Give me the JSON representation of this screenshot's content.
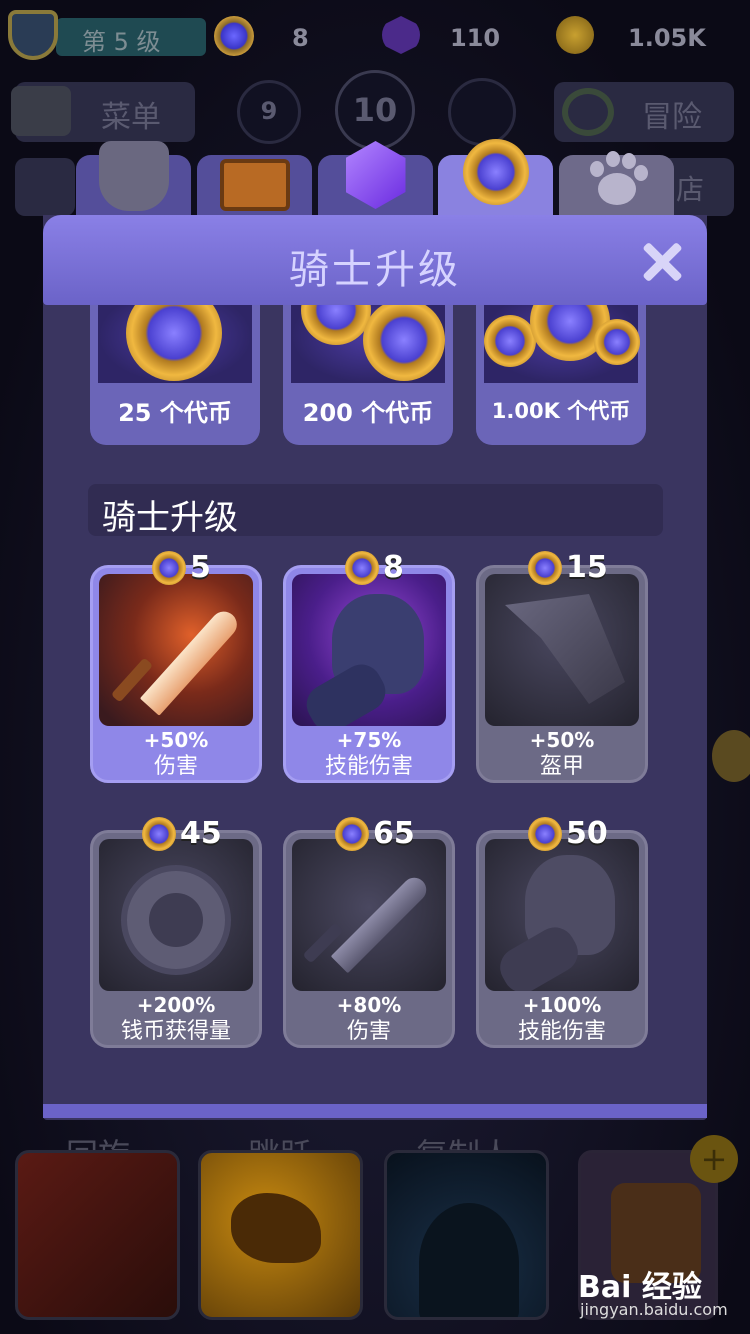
{
  "hud": {
    "level_text": "第 5 级",
    "tokens": "8",
    "gems": "110",
    "gold": "1.05K"
  },
  "nav": {
    "menu_label": "菜单",
    "stage_prev": "9",
    "stage_current": "10",
    "adventure_label": "冒险",
    "shop_partial": "店"
  },
  "tabs": [
    {
      "name": "gear",
      "icon": "stone-armor-icon"
    },
    {
      "name": "chest",
      "icon": "treasure-chest-icon"
    },
    {
      "name": "gems",
      "icon": "purple-gem-icon"
    },
    {
      "name": "tokens",
      "icon": "token-icon",
      "active": true
    },
    {
      "name": "pets",
      "icon": "paw-icon"
    }
  ],
  "dialog": {
    "title": "骑士升级",
    "section_title": "骑士升级"
  },
  "packs": [
    {
      "label": "25 个代币"
    },
    {
      "label": "200 个代币"
    },
    {
      "label": "1.00K 个代币"
    }
  ],
  "upgrades": [
    {
      "cost": "5",
      "value": "+50%",
      "name": "伤害",
      "state": "available",
      "icon": "sword-icon"
    },
    {
      "cost": "8",
      "value": "+75%",
      "name": "技能伤害",
      "state": "available",
      "icon": "gauntlet-icon"
    },
    {
      "cost": "15",
      "value": "+50%",
      "name": "盔甲",
      "state": "locked",
      "icon": "armor-plate-icon"
    },
    {
      "cost": "45",
      "value": "+200%",
      "name": "钱币获得量",
      "state": "locked",
      "icon": "skull-coin-icon"
    },
    {
      "cost": "65",
      "value": "+80%",
      "name": "伤害",
      "state": "locked",
      "icon": "sword-icon"
    },
    {
      "cost": "50",
      "value": "+100%",
      "name": "技能伤害",
      "state": "locked",
      "icon": "gauntlet-icon"
    }
  ],
  "skills": [
    {
      "label": "回旋"
    },
    {
      "label": "跳跃"
    },
    {
      "label": "复制人"
    }
  ],
  "watermark": {
    "brand": "Bai 经验",
    "url": "jingyan.baidu.com"
  }
}
